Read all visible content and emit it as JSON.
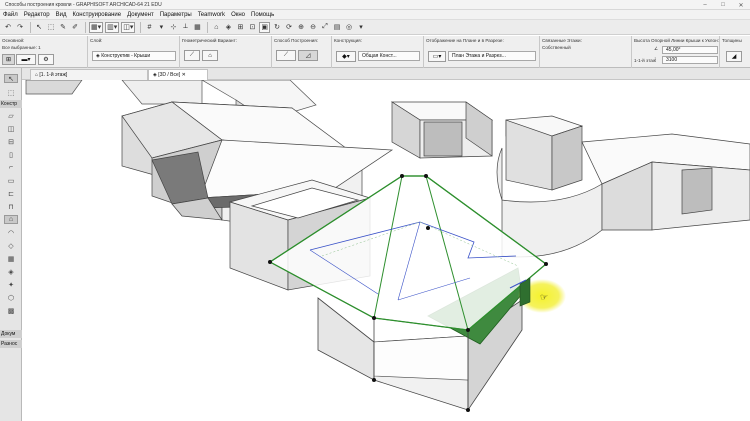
{
  "window": {
    "title": "Способы построения кровли - GRAPHISOFT ARCHICAD-64 21 EDU",
    "min": "–",
    "max": "□",
    "close": "✕"
  },
  "menu": [
    "Файл",
    "Редактор",
    "Вид",
    "Конструирование",
    "Документ",
    "Параметры",
    "Teamwork",
    "Окно",
    "Помощь"
  ],
  "infobox": {
    "main": {
      "label": "Основной:",
      "selected": "Все выбранные: 1"
    },
    "layer": {
      "label": "Слой:",
      "value": "Конструктив - Крыши"
    },
    "geometry": {
      "label": "Геометрический Вариант:"
    },
    "method": {
      "label": "Способ Построения:"
    },
    "structure": {
      "label": "Конструкция:",
      "value": "Общая Конст..."
    },
    "display": {
      "label": "Отображение на Плане и в Разрезе:",
      "value": "План Этажа и Разрез..."
    },
    "linked": {
      "label": "Связанные Этажи:",
      "value": "Собственный"
    },
    "height": {
      "label": "Высота Опорной Линии Крыши к Уклон:",
      "angle": "45,00°",
      "value": "3100",
      "story": "1-1-й этаж"
    },
    "trim": {
      "label": "Толщины"
    }
  },
  "tabs": [
    {
      "label": "[1. 1-й этаж]"
    },
    {
      "label": "[3D / Все]"
    }
  ],
  "leftpanel": {
    "select": "Основн",
    "construct": "Констр",
    "document": "Докум",
    "more": "Разнос"
  },
  "icons": {
    "cursor": "arrow-cursor-icon",
    "hand": "hand-cursor-icon"
  },
  "colors": {
    "selection": "#2e8f2e",
    "highlight": "#f2ef2a",
    "pitch": "#3a52c8"
  }
}
